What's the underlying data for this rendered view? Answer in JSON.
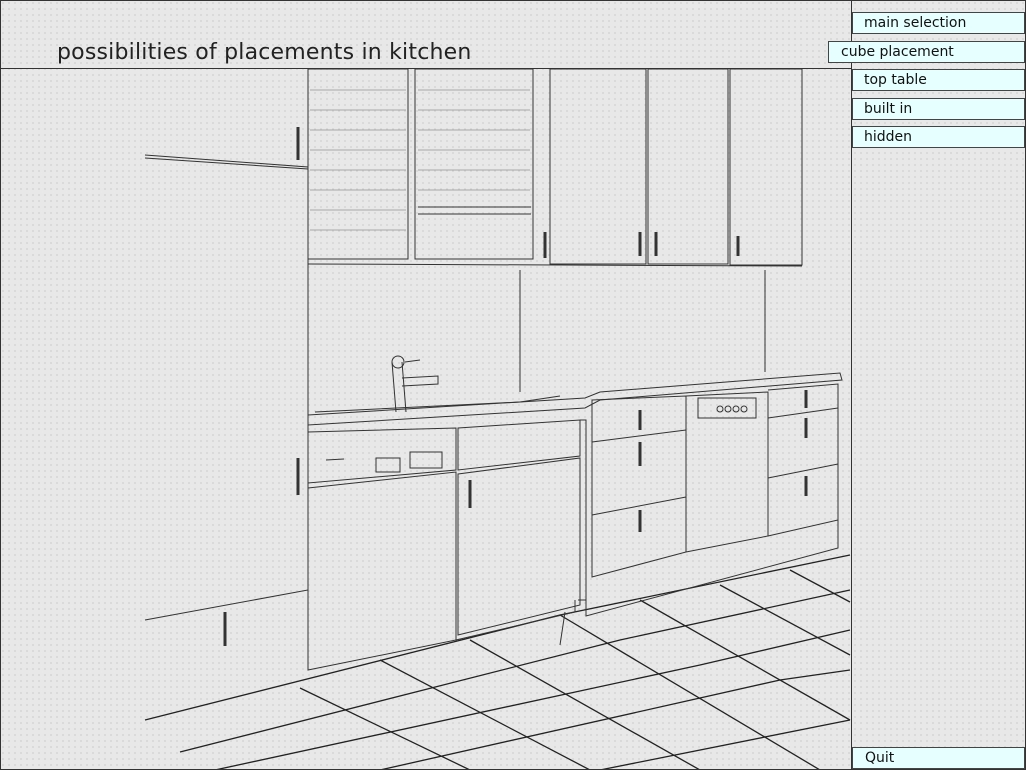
{
  "page": {
    "title": "possibilities of placements in kitchen"
  },
  "menu": {
    "main_selection": "main selection",
    "cube_placement": "cube placement",
    "top_table": "top table",
    "built_in": "built in",
    "hidden": "hidden",
    "quit": "Quit"
  }
}
